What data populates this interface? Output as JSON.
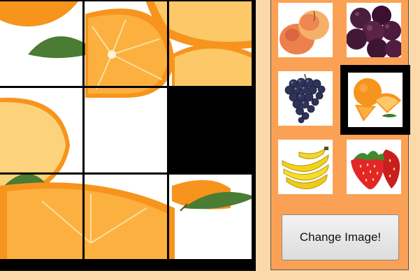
{
  "puzzle": {
    "image_name": "orange",
    "grid": {
      "rows": 4,
      "cols": 3
    },
    "empty_tile": {
      "row": 2,
      "col": 2
    }
  },
  "gallery": {
    "images": [
      {
        "name": "peaches",
        "icon": "peach-icon",
        "selected": false
      },
      {
        "name": "plums",
        "icon": "plum-icon",
        "selected": false
      },
      {
        "name": "grapes",
        "icon": "grapes-icon",
        "selected": false
      },
      {
        "name": "orange",
        "icon": "orange-icon",
        "selected": true
      },
      {
        "name": "bananas",
        "icon": "banana-icon",
        "selected": false
      },
      {
        "name": "strawberries",
        "icon": "strawberry-icon",
        "selected": false
      }
    ]
  },
  "controls": {
    "change_image_label": "Change Image!"
  },
  "colors": {
    "page_background": "#fbd9a8",
    "sidebar_background": "#fba155",
    "orange": "#f7941d",
    "tile_border": "#000000"
  }
}
